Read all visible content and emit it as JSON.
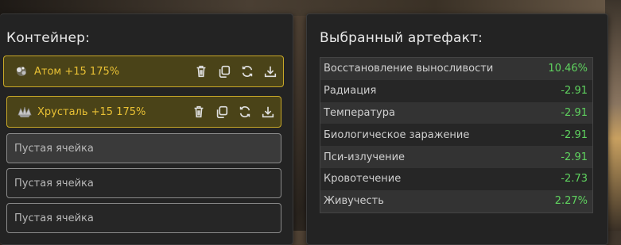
{
  "container": {
    "title": "Контейнер:",
    "slots": [
      {
        "state": "filled",
        "icon": "atom-artifact-icon",
        "label": "Атом +15 175%"
      },
      {
        "state": "filled",
        "icon": "crystal-artifact-icon",
        "label": "Хрусталь +15 175%"
      },
      {
        "state": "empty",
        "label": "Пустая ячейка"
      },
      {
        "state": "empty",
        "label": "Пустая ячейка"
      },
      {
        "state": "empty",
        "label": "Пустая ячейка"
      }
    ],
    "actions": [
      "delete-icon",
      "copy-icon",
      "refresh-icon",
      "download-icon"
    ]
  },
  "artifact": {
    "title": "Выбранный артефакт:",
    "stats": [
      {
        "name": "Восстановление выносливости",
        "value": "10.46%"
      },
      {
        "name": "Радиация",
        "value": "-2.91"
      },
      {
        "name": "Температура",
        "value": "-2.91"
      },
      {
        "name": "Биологическое заражение",
        "value": "-2.91"
      },
      {
        "name": "Пси-излучение",
        "value": "-2.91"
      },
      {
        "name": "Кровотечение",
        "value": "-2.73"
      },
      {
        "name": "Живучесть",
        "value": "2.27%"
      }
    ]
  },
  "colors": {
    "accent_gold": "#c8a828",
    "positive_green": "#5fd35f",
    "panel_bg": "#232323"
  }
}
